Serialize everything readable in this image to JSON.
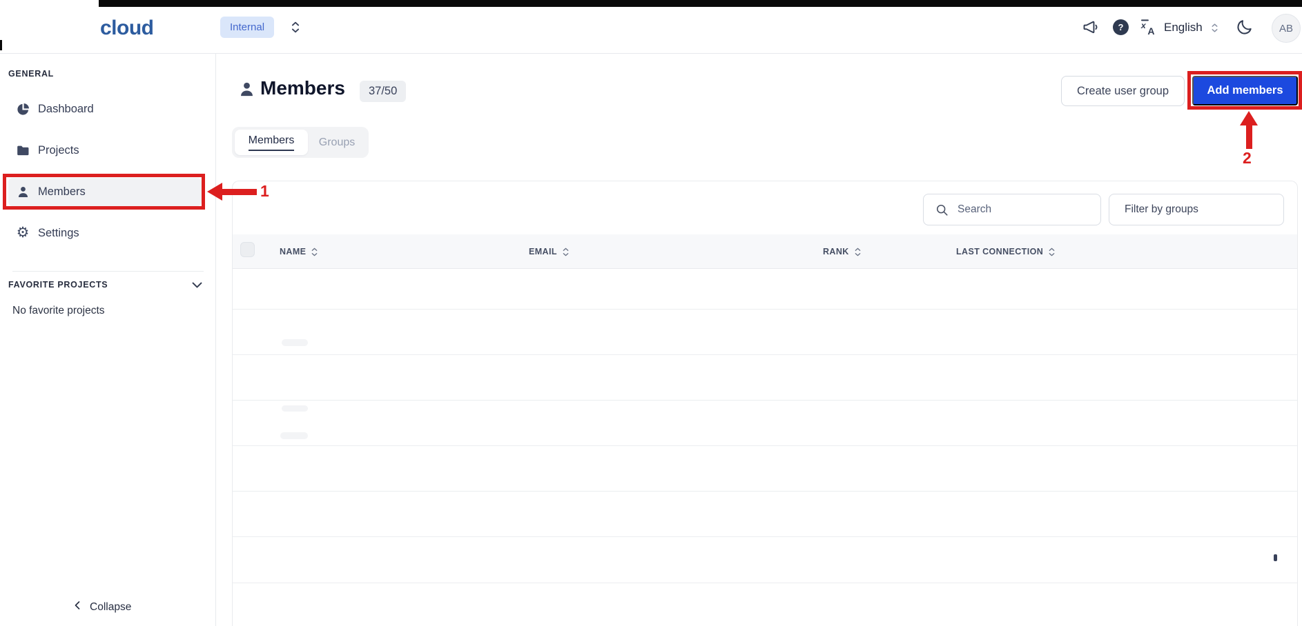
{
  "topbar": {
    "logo_text": "cloud",
    "org_badge": "Internal",
    "help_glyph": "?",
    "language_label": "English",
    "avatar_initials": "AB"
  },
  "sidebar": {
    "general_section_label": "GENERAL",
    "items": [
      {
        "label": "Dashboard",
        "icon": "pie-chart-icon",
        "selected": false
      },
      {
        "label": "Projects",
        "icon": "folder-icon",
        "selected": false
      },
      {
        "label": "Members",
        "icon": "person-icon",
        "selected": true
      },
      {
        "label": "Settings",
        "icon": "gear-icon",
        "selected": false
      }
    ],
    "favorites_section_label": "FAVORITE PROJECTS",
    "favorites_empty_text": "No favorite projects",
    "collapse_label": "Collapse"
  },
  "page": {
    "title": "Members",
    "count_badge": "37/50"
  },
  "actions": {
    "create_user_group": "Create user group",
    "add_members": "Add members"
  },
  "tabs": [
    {
      "label": "Members",
      "active": true
    },
    {
      "label": "Groups",
      "active": false
    }
  ],
  "toolbar": {
    "search_placeholder": "Search",
    "filter_by_groups": "Filter by groups"
  },
  "table": {
    "columns": [
      {
        "label": "NAME",
        "sortable": true
      },
      {
        "label": "EMAIL",
        "sortable": true
      },
      {
        "label": "RANK",
        "sortable": true
      },
      {
        "label": "LAST CONNECTION",
        "sortable": true
      }
    ],
    "row_count": 8,
    "rows_empty": true
  },
  "annotations": {
    "step_1_label": "1",
    "step_2_label": "2"
  },
  "colors": {
    "annotation_red": "#dc1f1f",
    "primary_blue": "#1c49df",
    "logo_blue": "#2d5c9f",
    "org_badge_bg": "#dae6fa",
    "org_badge_text": "#4468cd",
    "table_header_bg": "#f7f8fa"
  }
}
